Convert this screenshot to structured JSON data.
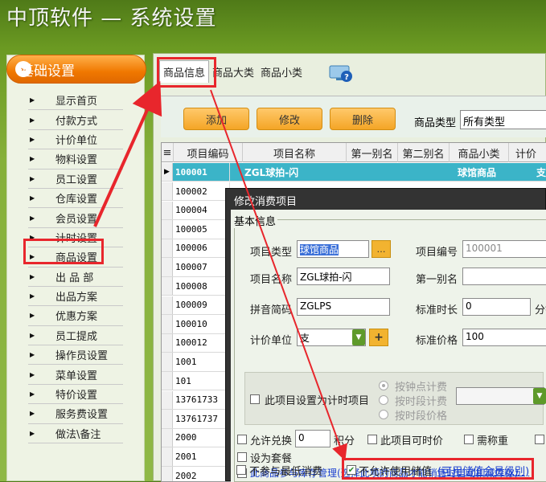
{
  "window": {
    "title": "中顶软件 — 系统设置"
  },
  "sidebar": {
    "header": "基础设置",
    "items": [
      "显示首页",
      "付款方式",
      "计价单位",
      "物料设置",
      "员工设置",
      "仓库设置",
      "会员设置",
      "计时设置",
      "商品设置",
      "出 品 部",
      "出品方案",
      "优惠方案",
      "员工提成",
      "操作员设置",
      "菜单设置",
      "特价设置",
      "服务费设置",
      "做法\\备注"
    ]
  },
  "tabs": [
    "商品信息",
    "商品大类",
    "商品小类"
  ],
  "toolbar": {
    "add": "添加",
    "edit": "修改",
    "delete": "删除",
    "category_label": "商品类型",
    "category_value": "所有类型"
  },
  "table": {
    "headers": [
      "项目编码",
      "项目名称",
      "第一别名",
      "第二别名",
      "商品小类",
      "计价"
    ],
    "selected_row": {
      "code": "100001",
      "name": "ZGL球拍-闪",
      "subcat": "球馆商品",
      "price_unit": "支"
    },
    "codes": [
      "100002",
      "100004",
      "100005",
      "100006",
      "100007",
      "100008",
      "100009",
      "100010",
      "100012",
      "1001",
      "101",
      "13761733",
      "13761737",
      "2000",
      "2001",
      "2002"
    ]
  },
  "dialog": {
    "title": "修改消费项目",
    "group": "基本信息",
    "item_type_label": "项目类型",
    "item_type_value": "球馆商品",
    "item_no_label": "项目编号",
    "item_no_value": "100001",
    "item_name_label": "项目名称",
    "item_name_value": "ZGL球拍-闪",
    "alias1_label": "第一别名",
    "pinyin_label": "拼音简码",
    "pinyin_value": "ZGLPS",
    "std_duration_label": "标准时长",
    "std_duration_value": "0",
    "std_duration_unit": "分钟",
    "unit_label": "计价单位",
    "unit_value": "支",
    "std_price_label": "标准价格",
    "std_price_value": "100",
    "timer_item": "此项目设置为计时项目",
    "radio_hour": "按钟点计费",
    "radio_period_fee": "按时段计费",
    "radio_period_price": "按时段价格",
    "allow_exchange": "允许兑换",
    "exchange_value": "0",
    "points_unit": "积分",
    "timed_price": "此项目可时价",
    "need_weigh": "需称重",
    "set_package": "设为套餐",
    "inventory": "此商品参与库存管理(选择此项的商品才能销售时自动扣减库存)",
    "no_min_consume": "不参与最低消费",
    "no_stored_value": "不允许使用储值",
    "member_level_link": "(可用储值会员级别)"
  },
  "colors": {
    "accent_orange": "#f07800",
    "highlight_red": "#e8262c",
    "selection_teal": "#3bb4c8"
  }
}
